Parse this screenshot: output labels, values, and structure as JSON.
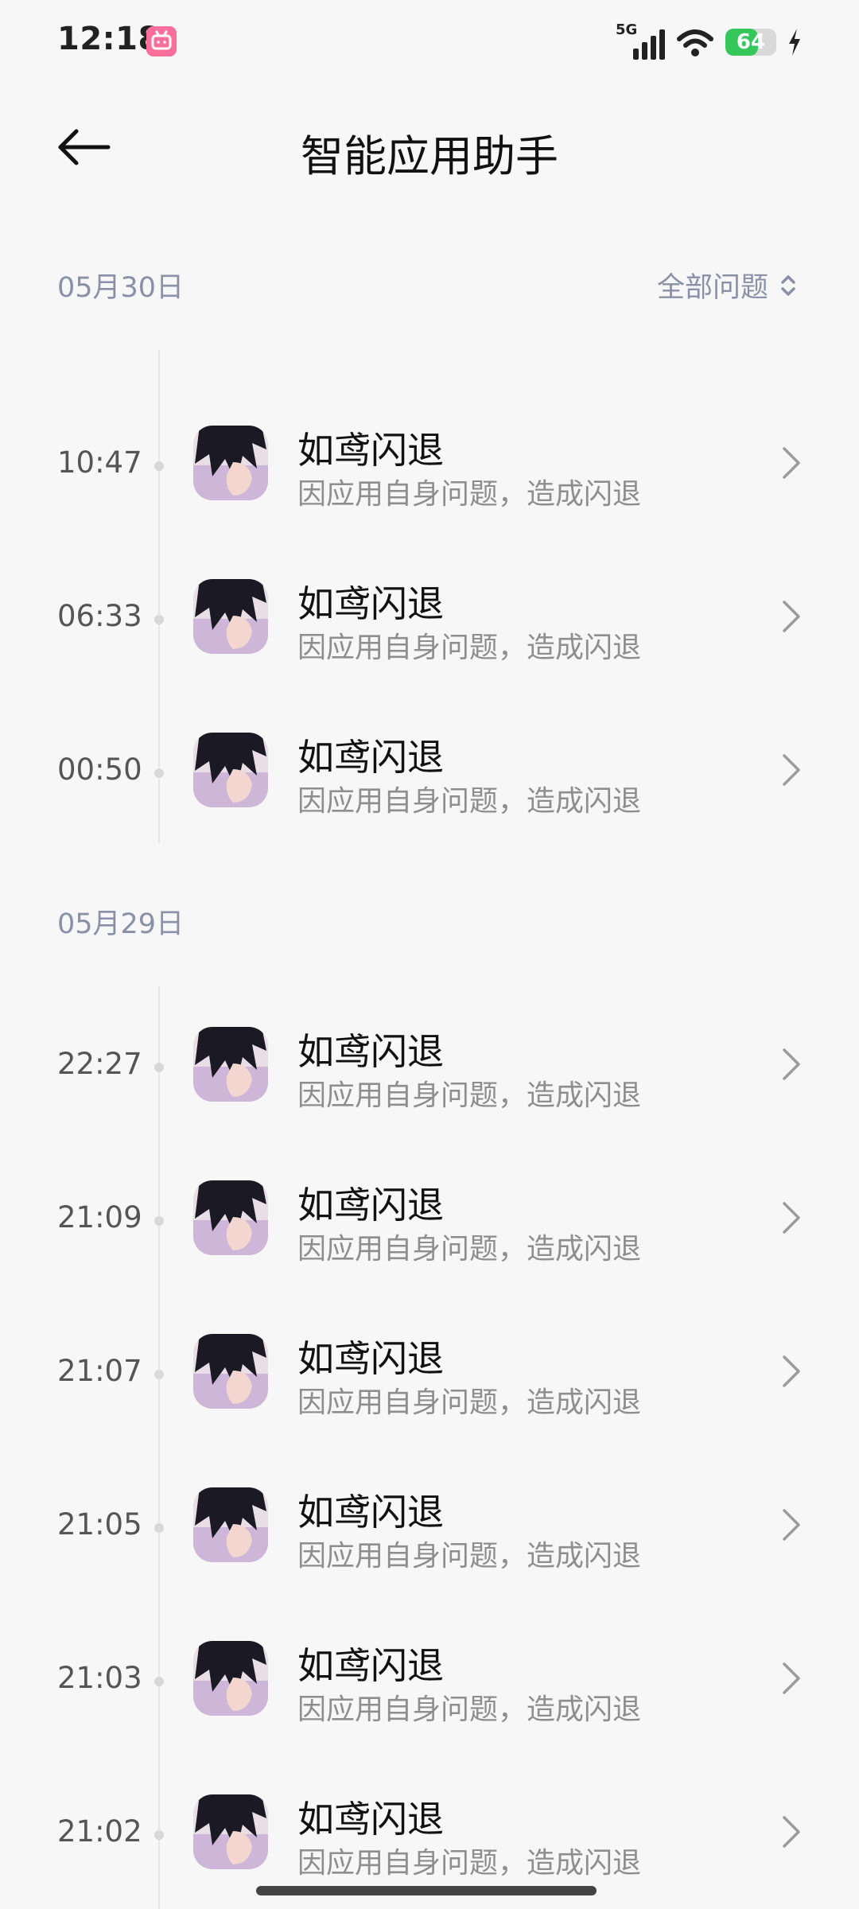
{
  "status_bar": {
    "time": "12:18",
    "app_badge": "bilibili",
    "network": "5G",
    "battery": "64",
    "battery_level": 0.64
  },
  "header": {
    "title": "智能应用助手"
  },
  "filter": {
    "label": "全部问题"
  },
  "sections": [
    {
      "date": "05月30日",
      "items": [
        {
          "time": "10:47",
          "title": "如鸢闪退",
          "subtitle": "因应用自身问题，造成闪退"
        },
        {
          "time": "06:33",
          "title": "如鸢闪退",
          "subtitle": "因应用自身问题，造成闪退"
        },
        {
          "time": "00:50",
          "title": "如鸢闪退",
          "subtitle": "因应用自身问题，造成闪退"
        }
      ]
    },
    {
      "date": "05月29日",
      "items": [
        {
          "time": "22:27",
          "title": "如鸢闪退",
          "subtitle": "因应用自身问题，造成闪退"
        },
        {
          "time": "21:09",
          "title": "如鸢闪退",
          "subtitle": "因应用自身问题，造成闪退"
        },
        {
          "time": "21:07",
          "title": "如鸢闪退",
          "subtitle": "因应用自身问题，造成闪退"
        },
        {
          "time": "21:05",
          "title": "如鸢闪退",
          "subtitle": "因应用自身问题，造成闪退"
        },
        {
          "time": "21:03",
          "title": "如鸢闪退",
          "subtitle": "因应用自身问题，造成闪退"
        },
        {
          "time": "21:02",
          "title": "如鸢闪退",
          "subtitle": "因应用自身问题，造成闪退"
        }
      ]
    }
  ],
  "colors": {
    "background": "#f7f7f7",
    "accent_muted": "#8a90a8",
    "battery_green": "#35c759"
  }
}
